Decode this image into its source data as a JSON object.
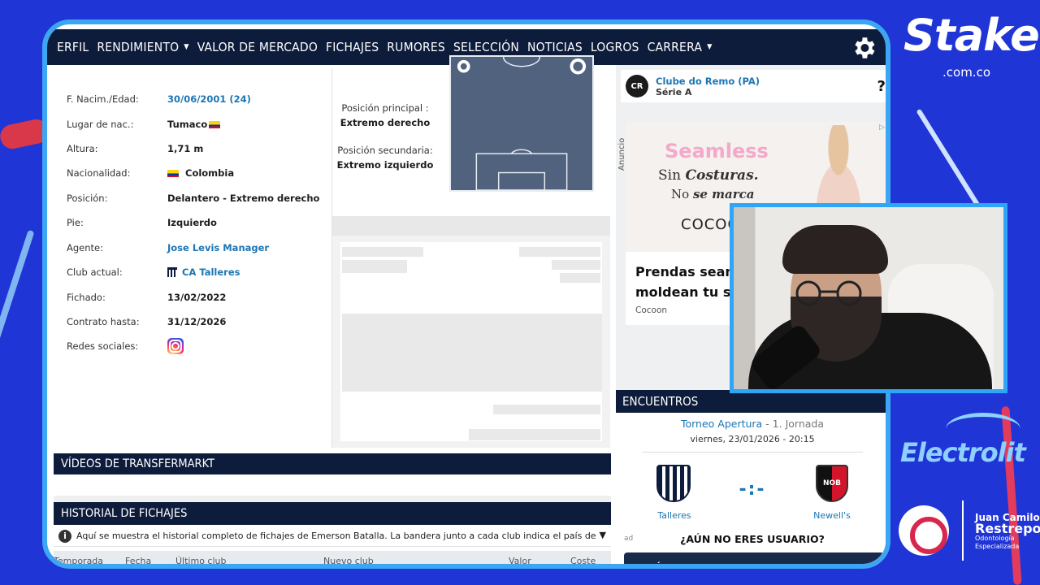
{
  "nav": {
    "items": [
      {
        "label": "ERFIL",
        "caret": false
      },
      {
        "label": "RENDIMIENTO",
        "caret": true
      },
      {
        "label": "VALOR DE MERCADO",
        "caret": false
      },
      {
        "label": "FICHAJES",
        "caret": false
      },
      {
        "label": "RUMORES",
        "caret": false
      },
      {
        "label": "SELECCIÓN",
        "caret": false
      },
      {
        "label": "NOTICIAS",
        "caret": false
      },
      {
        "label": "LOGROS",
        "caret": false
      },
      {
        "label": "CARRERA",
        "caret": true
      }
    ]
  },
  "profile": {
    "rows": [
      {
        "label": "F. Nacim./Edad:",
        "value": "30/06/2001 (24)"
      },
      {
        "label": "Lugar de nac.:",
        "value": "Tumaco"
      },
      {
        "label": "Altura:",
        "value": "1,71 m"
      },
      {
        "label": "Nacionalidad:",
        "value": "Colombia"
      },
      {
        "label": "Posición:",
        "value": "Delantero - Extremo derecho"
      },
      {
        "label": "Pie:",
        "value": "Izquierdo"
      },
      {
        "label": "Agente:",
        "value": "Jose Levis Manager"
      },
      {
        "label": "Club actual:",
        "value": "CA Talleres"
      },
      {
        "label": "Fichado:",
        "value": "13/02/2022"
      },
      {
        "label": "Contrato hasta:",
        "value": "31/12/2026"
      },
      {
        "label": "Redes sociales:",
        "value": ""
      }
    ],
    "flag_colors": [
      "#fcd116",
      "#003893",
      "#ce1126"
    ]
  },
  "positions": {
    "main_label": "Posición principal :",
    "main_value": "Extremo derecho",
    "secondary_label": "Posición secundaria:",
    "secondary_value": "Extremo izquierdo"
  },
  "videos": {
    "title": "VÍDEOS DE TRANSFERMARKT"
  },
  "history": {
    "title": "HISTORIAL DE FICHAJES",
    "note": "Aquí se muestra el historial completo de fichajes de Emerson Batalla. La bandera junto a cada club indica el país de la liga a la que pertenece ...",
    "columns": [
      "Temporada",
      "Fecha",
      "Último club",
      "Nuevo club",
      "Valor",
      "Coste"
    ]
  },
  "side_club": {
    "name": "Clube do Remo (PA)",
    "league": "Série A",
    "marker": "?"
  },
  "ad": {
    "label": "Anuncio",
    "seamless": "Seamless",
    "sin": "Sin",
    "costuras": "Costuras.",
    "no": "No",
    "se_marca": "se marca",
    "cocoon_logo": "COCOO",
    "headline_1": "Prendas seam",
    "headline_2": "moldean tu sil",
    "brand": "Cocoon"
  },
  "encuentros": {
    "title": "ENCUENTROS",
    "tournament": "Torneo Apertura",
    "jornada": "- 1. Jornada",
    "date": "viernes, 23/01/2026 - 20:15",
    "home": "Talleres",
    "away": "Newell's",
    "home_badge": "C.A.T",
    "away_badge": "NOB",
    "score": "-:-",
    "ad_tag": "ad",
    "question": "¿AÚN NO ERES USUARIO?",
    "register": "¡REGÍSTRATE Y RECIBE TU BONO DE BIENVENIDA"
  },
  "sponsors": {
    "stake": "Stake",
    "stake_domain": ".com.co",
    "electrolit": "Electrolit",
    "dentist_first": "Juan Camilo",
    "dentist_last": "Restrepo",
    "dentist_sub1": "Odontología",
    "dentist_sub2": "Especializada"
  },
  "colors": {
    "navy": "#0e1c3c",
    "link": "#1d75b3",
    "stream_blue": "#1f35d6",
    "frame_border": "#3da6f2"
  }
}
